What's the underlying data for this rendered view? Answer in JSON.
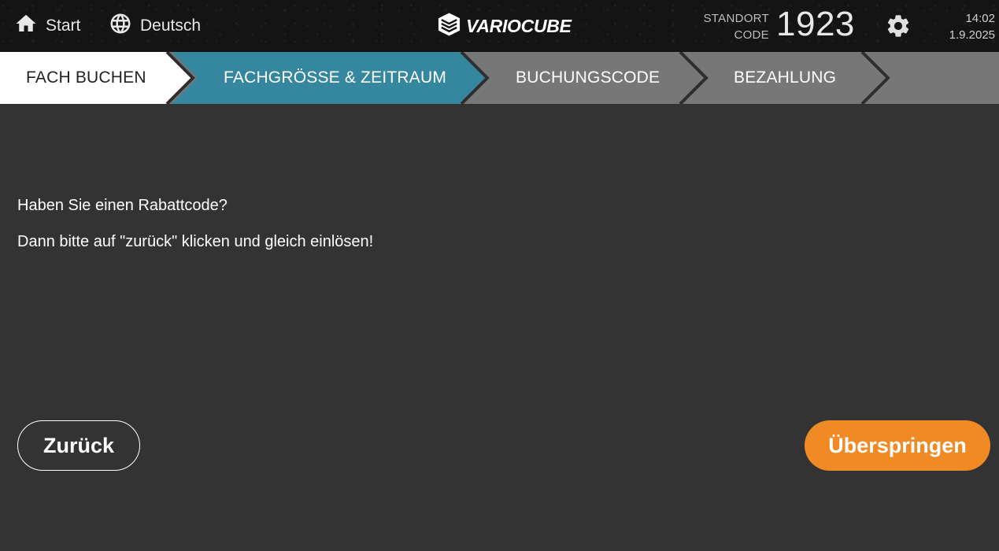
{
  "header": {
    "start_label": "Start",
    "language_label": "Deutsch",
    "logo_text": "VARIOCUBE",
    "standort_label_line1": "STANDORT",
    "standort_label_line2": "CODE",
    "standort_code": "1923",
    "time": "14:02",
    "date": "1.9.2025",
    "icons": [
      "home-icon",
      "globe-icon",
      "variocube-logo-icon",
      "gear-icon"
    ]
  },
  "steps": [
    {
      "label": "FACH BUCHEN",
      "state": "done",
      "color": "#ffffff"
    },
    {
      "label": "FACHGRÖSSE & ZEITRAUM",
      "state": "active",
      "color": "#34879e"
    },
    {
      "label": "BUCHUNGSCODE",
      "state": "pending",
      "color": "#777777"
    },
    {
      "label": "BEZAHLUNG",
      "state": "pending",
      "color": "#777777"
    }
  ],
  "main": {
    "line1": "Haben Sie einen Rabattcode?",
    "line2": "Dann bitte auf \"zurück\" klicken und gleich einlösen!"
  },
  "actions": {
    "back_label": "Zurück",
    "skip_label": "Überspringen",
    "skip_color": "#f08a24"
  }
}
